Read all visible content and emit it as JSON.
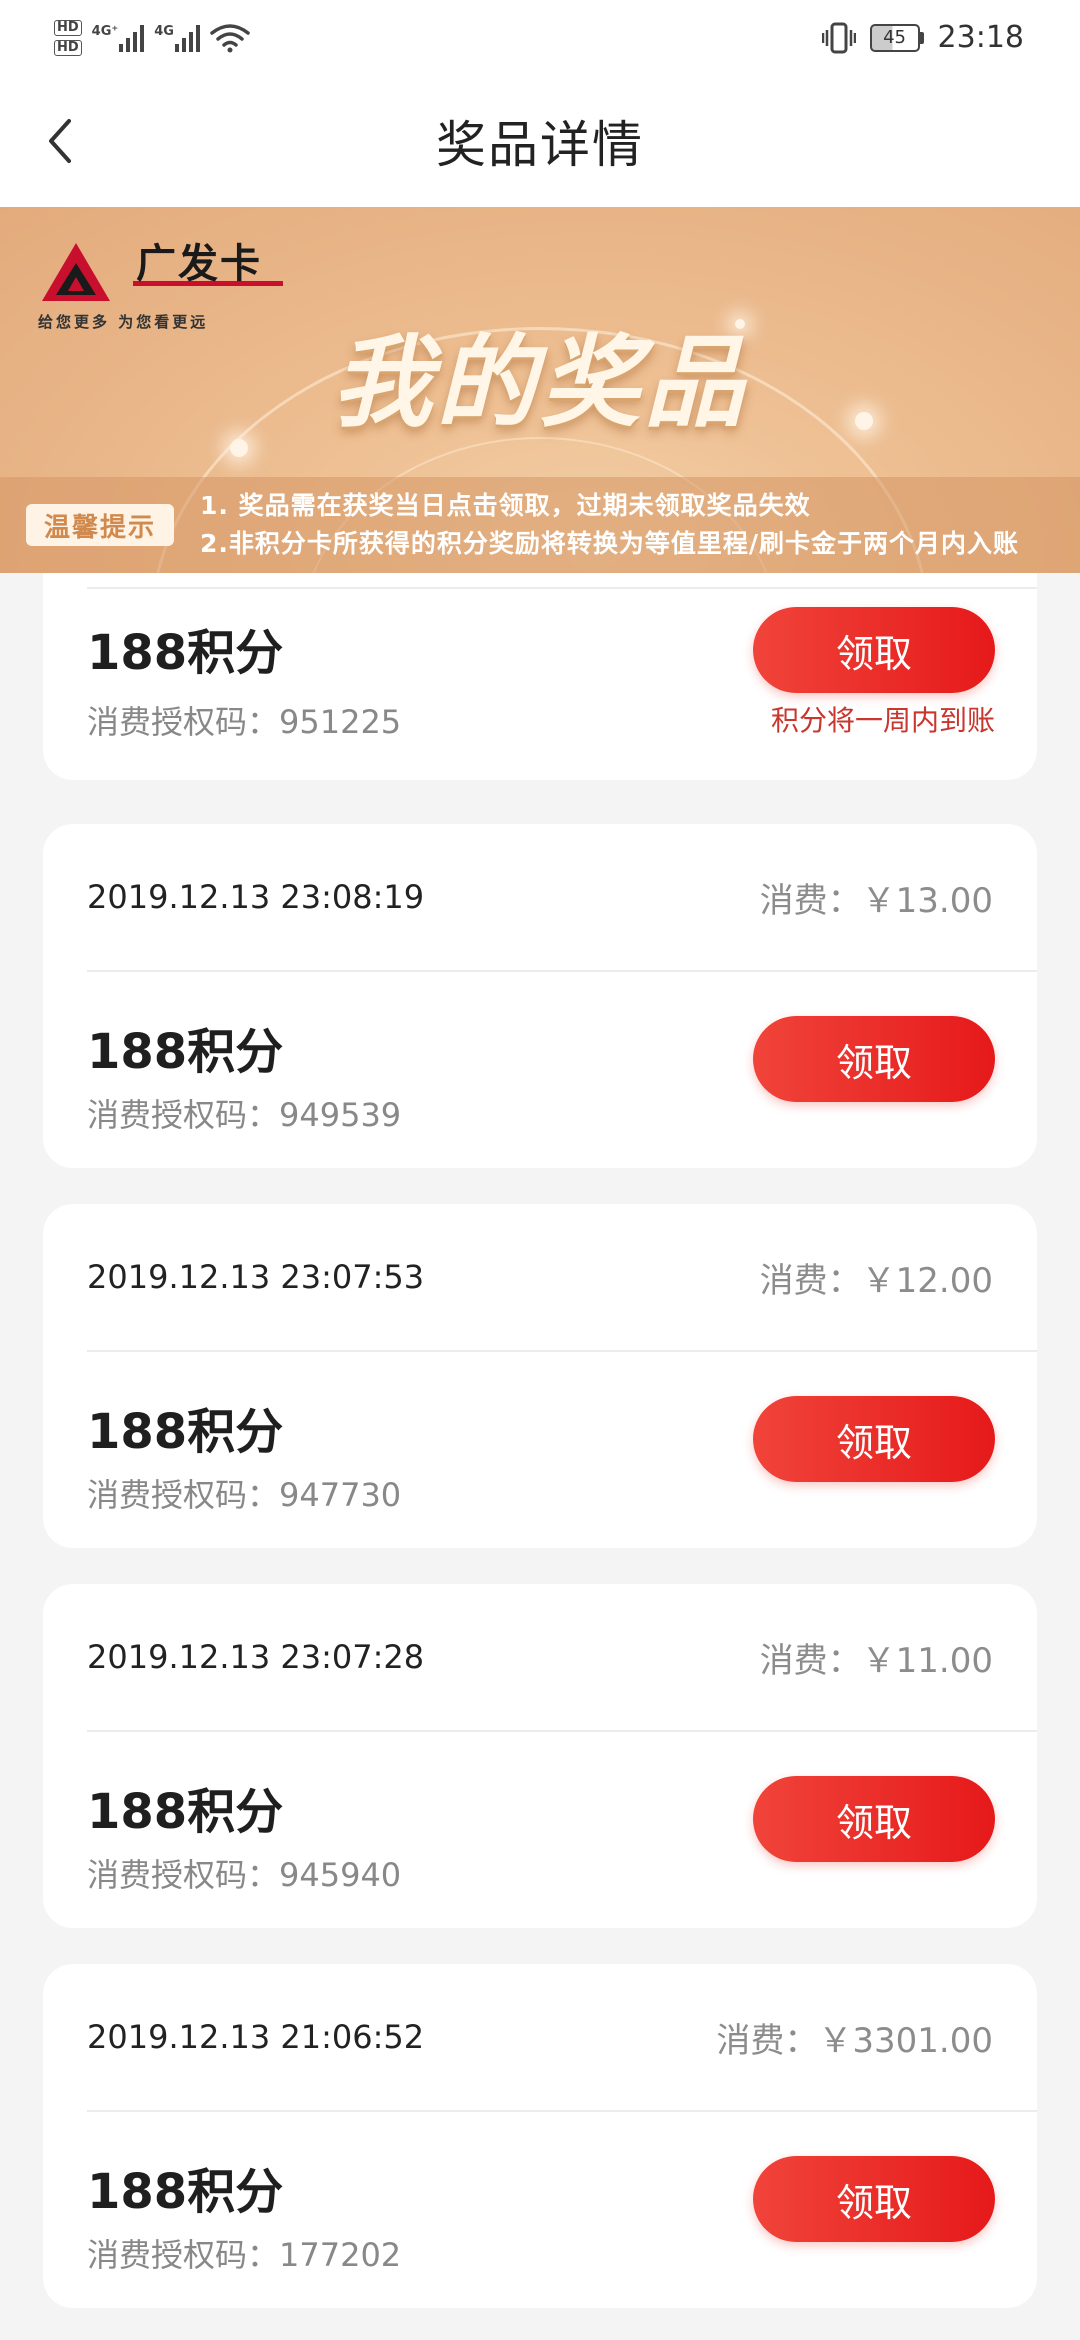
{
  "status_bar": {
    "hd1": "HD",
    "hd2": "HD",
    "net1": "4G⁺",
    "net2": "4G",
    "battery": "45",
    "time": "23:18"
  },
  "header": {
    "title": "奖品详情"
  },
  "banner": {
    "logo_name": "广发卡",
    "logo_sub": "给您更多  为您看更远",
    "title": "我的奖品",
    "notice_badge": "温馨提示",
    "notice_lines": [
      "1. 奖品需在获奖当日点击领取，过期未领取奖品失效",
      "2.非积分卡所获得的积分奖励将转换为等值里程/刷卡金于两个月内入账"
    ]
  },
  "first_item": {
    "points": "188积分",
    "auth_code": "消费授权码：951225",
    "button": "领取",
    "note": "积分将一周内到账"
  },
  "items": [
    {
      "datetime": "2019.12.13 23:08:19",
      "spend": "消费：￥13.00",
      "points": "188积分",
      "auth_code": "消费授权码：949539",
      "button": "领取"
    },
    {
      "datetime": "2019.12.13 23:07:53",
      "spend": "消费：￥12.00",
      "points": "188积分",
      "auth_code": "消费授权码：947730",
      "button": "领取"
    },
    {
      "datetime": "2019.12.13 23:07:28",
      "spend": "消费：￥11.00",
      "points": "188积分",
      "auth_code": "消费授权码：945940",
      "button": "领取"
    },
    {
      "datetime": "2019.12.13 21:06:52",
      "spend": "消费：￥3301.00",
      "points": "188积分",
      "auth_code": "消费授权码：177202",
      "button": "领取"
    }
  ],
  "colors": {
    "accent_red": "#e6191a",
    "note_red": "#c8362e",
    "banner_gold": "#e9b78a"
  }
}
